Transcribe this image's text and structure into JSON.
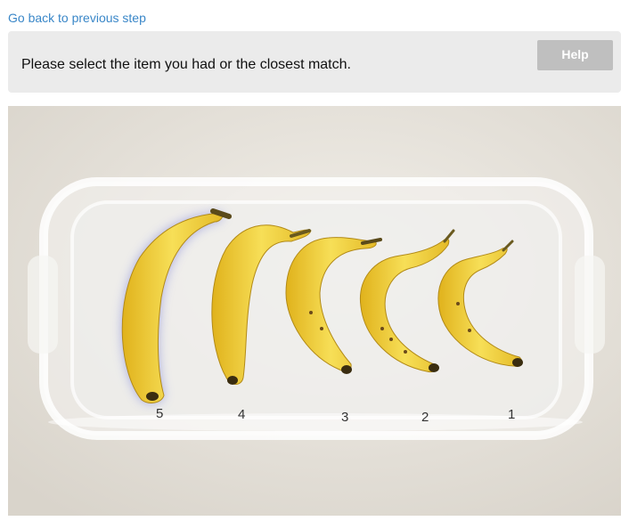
{
  "nav": {
    "back_label": "Go back to previous step"
  },
  "prompt": {
    "text": "Please select the item you had or the closest match.",
    "help_label": "Help"
  },
  "photo": {
    "subject": "bananas-on-tray",
    "options": [
      {
        "label": "5",
        "selected": true
      },
      {
        "label": "4",
        "selected": false
      },
      {
        "label": "3",
        "selected": false
      },
      {
        "label": "2",
        "selected": false
      },
      {
        "label": "1",
        "selected": false
      }
    ]
  },
  "colors": {
    "link": "#3a87c8",
    "panel_bg": "#ebebeb",
    "help_bg": "#bfbfbf",
    "highlight": "#6b6fd6"
  }
}
